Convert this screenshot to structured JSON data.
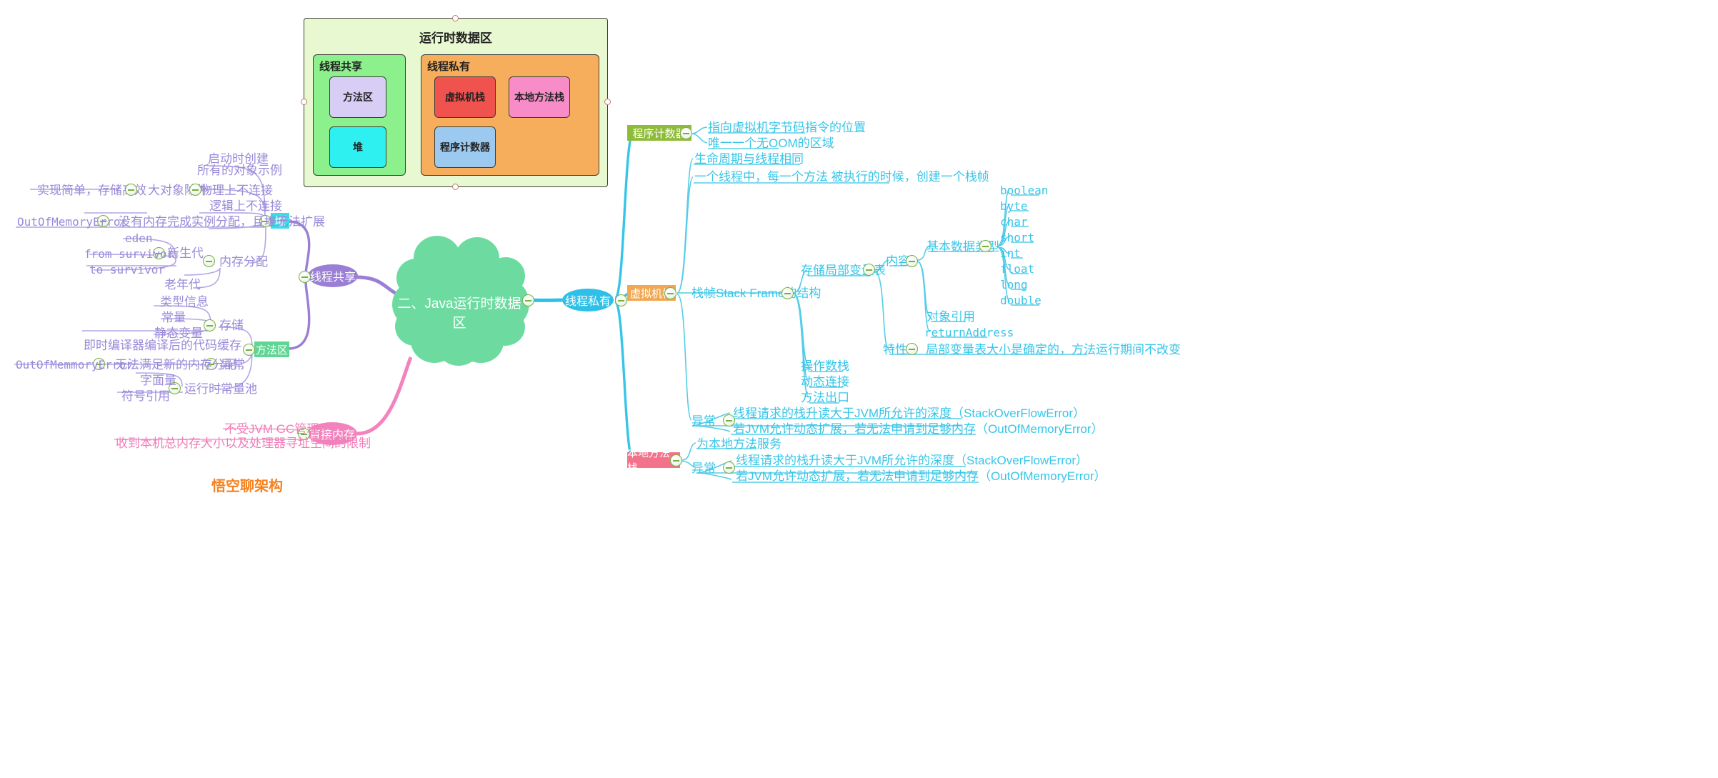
{
  "diagram": {
    "title": "运行时数据区",
    "shared": {
      "header": "线程共享",
      "items": [
        "方法区",
        "堆"
      ]
    },
    "private": {
      "header": "线程私有",
      "items": [
        "虚拟机栈",
        "本地方法栈",
        "程序计数器"
      ]
    }
  },
  "root": {
    "label": "二、Java运行时数据区"
  },
  "branches": {
    "shared": {
      "label": "线程共享"
    },
    "direct": {
      "label": "直接内存"
    },
    "private": {
      "label": "线程私有"
    }
  },
  "heap": {
    "label": "堆",
    "items": [
      "启动时创建",
      "所有的对象示例",
      "物理上不连接",
      "逻辑上不连接"
    ],
    "bigobj": "大对象除外",
    "bigobj_child": "实现简单，存储高效",
    "oom_detail": "没有内存完成实例分配，且堆无法扩展",
    "oom_label": "OutOfMemoryError",
    "alloc": {
      "label": "内存分配",
      "young": {
        "label": "新生代",
        "items": [
          "eden",
          "from survivor",
          "to survivor"
        ]
      },
      "old": "老年代"
    }
  },
  "method_area": {
    "label": "方法区",
    "storage": {
      "label": "存储",
      "items": [
        "类型信息",
        "常量",
        "静态变量",
        "即时编译器编译后的代码缓存"
      ]
    },
    "exception": {
      "label": "异常",
      "detail": "无法满足新的内存分配",
      "error": "OutOfMemmoryError"
    },
    "constant_pool": {
      "label": "运行时常量池",
      "items": [
        "字面量",
        "符号引用"
      ]
    }
  },
  "direct_memory": {
    "items": [
      "不受JVM GC管理",
      "收到本机总内存大小以及处理器寻址空间的限制"
    ]
  },
  "pc_register": {
    "label": "程序计数器",
    "items": [
      "指向虚拟机字节码指令的位置",
      "唯一一个无OOM的区域"
    ]
  },
  "vm_stack": {
    "label": "虚拟机栈",
    "items": [
      "生命周期与线程相同",
      "一个线程中，每一个方法 被执行的时候，创建一个栈帧"
    ],
    "frame": {
      "label": "栈帧Stack Frame的结构",
      "locals": {
        "label": "存储局部变量表",
        "content": {
          "label": "内容",
          "primitives": {
            "label": "基本数据类型",
            "items": [
              "boolean",
              "byte",
              "char",
              "short",
              "int",
              "float",
              "long",
              "double"
            ]
          },
          "others": [
            "对象引用",
            "returnAddress"
          ]
        },
        "feature": {
          "label": "特性",
          "detail": "局部变量表大小是确定的，方法运行期间不改变"
        }
      },
      "others": [
        "操作数栈",
        "动态连接",
        "方法出口"
      ]
    },
    "exception": {
      "label": "异常",
      "items": [
        "线程请求的栈升读大于JVM所允许的深度（StackOverFlowError）",
        "若JVM允许动态扩展，若无法申请到足够内存（OutOfMemoryError）"
      ]
    }
  },
  "native_stack": {
    "label": "本地方法栈",
    "purpose": "为本地方法服务",
    "exception": {
      "label": "异常",
      "items": [
        "线程请求的栈升读大于JVM所允许的深度（StackOverFlowError）",
        "若JVM允许动态扩展，若无法申请到足够内存（OutOfMemoryError）"
      ]
    }
  },
  "watermark": "悟空聊架构"
}
